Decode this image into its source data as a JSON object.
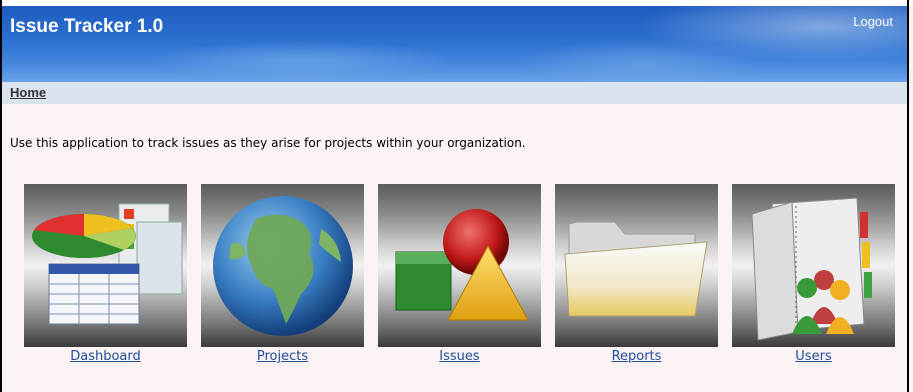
{
  "app": {
    "title": "Issue Tracker 1.0",
    "logout_label": "Logout"
  },
  "breadcrumb": {
    "home": "Home"
  },
  "intro": "Use this application to track issues as they arise for projects within your organization.",
  "tiles": [
    {
      "label": "Dashboard",
      "icon": "dashboard-icon"
    },
    {
      "label": "Projects",
      "icon": "globe-icon"
    },
    {
      "label": "Issues",
      "icon": "shapes-icon"
    },
    {
      "label": "Reports",
      "icon": "folder-icon"
    },
    {
      "label": "Users",
      "icon": "users-book-icon"
    }
  ],
  "colors": {
    "header": "#2e72d2",
    "link": "#1f4e99",
    "background": "#fbf3f3"
  }
}
